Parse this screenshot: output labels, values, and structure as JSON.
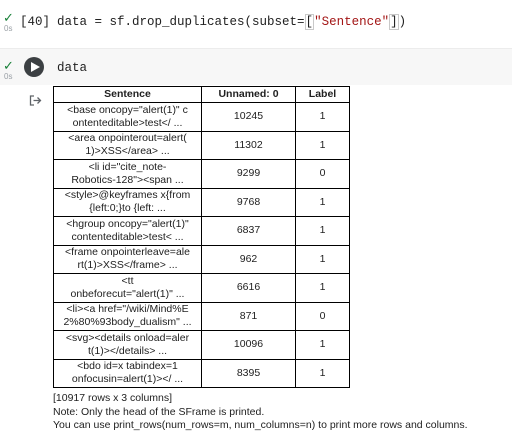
{
  "cells": [
    {
      "status_icon": "checkmark-icon",
      "exec_time": "0s",
      "exec_count": "[40]",
      "code": {
        "prefix": "data = sf.drop_duplicates(subset=",
        "bracket_open": "[",
        "string": "\"Sentence\"",
        "bracket_close": "]",
        "suffix": ")"
      }
    },
    {
      "status_icon": "checkmark-icon",
      "exec_time": "0s",
      "run_icon": "play-icon",
      "code": "data"
    }
  ],
  "output": {
    "icon": "output-arrow-icon",
    "table": {
      "headers": [
        "Sentence",
        "Unnamed: 0",
        "Label"
      ],
      "rows": [
        {
          "sentence_1": "<base oncopy=\"alert(1)\" c",
          "sentence_2": "ontenteditable>test</ ...",
          "unnamed": "10245",
          "label": "1"
        },
        {
          "sentence_1": "<area onpointerout=alert(",
          "sentence_2": "1)>XSS</area> ...",
          "unnamed": "11302",
          "label": "1"
        },
        {
          "sentence_1": "<li id=\"cite_note-",
          "sentence_2": "Robotics-128\"><span ...",
          "unnamed": "9299",
          "label": "0"
        },
        {
          "sentence_1": "<style>@keyframes x{from",
          "sentence_2": "{left:0;}to {left: ...",
          "unnamed": "9768",
          "label": "1"
        },
        {
          "sentence_1": "<hgroup oncopy=\"alert(1)\"",
          "sentence_2": "contenteditable>test< ...",
          "unnamed": "6837",
          "label": "1"
        },
        {
          "sentence_1": "<frame onpointerleave=ale",
          "sentence_2": "rt(1)>XSS</frame> ...",
          "unnamed": "962",
          "label": "1"
        },
        {
          "sentence_1": "<tt",
          "sentence_2": "onbeforecut=\"alert(1)\" ...",
          "unnamed": "6616",
          "label": "1"
        },
        {
          "sentence_1": "<li><a href=\"/wiki/Mind%E",
          "sentence_2": "2%80%93body_dualism\" ...",
          "unnamed": "871",
          "label": "0"
        },
        {
          "sentence_1": "<svg><details onload=aler",
          "sentence_2": "t(1)></details> ...",
          "unnamed": "10096",
          "label": "1"
        },
        {
          "sentence_1": "<bdo id=x tabindex=1",
          "sentence_2": "onfocusin=alert(1)></ ...",
          "unnamed": "8395",
          "label": "1"
        }
      ]
    },
    "summary": "[10917 rows x 3 columns]",
    "note": "Note: Only the head of the SFrame is printed.",
    "hint": "You can use print_rows(num_rows=m, num_columns=n) to print more rows and columns."
  },
  "colors": {
    "check": "#188038",
    "string_literal": "#a31515",
    "run_button": "#3c4043",
    "active_cell_bg": "#f7f7f7"
  }
}
